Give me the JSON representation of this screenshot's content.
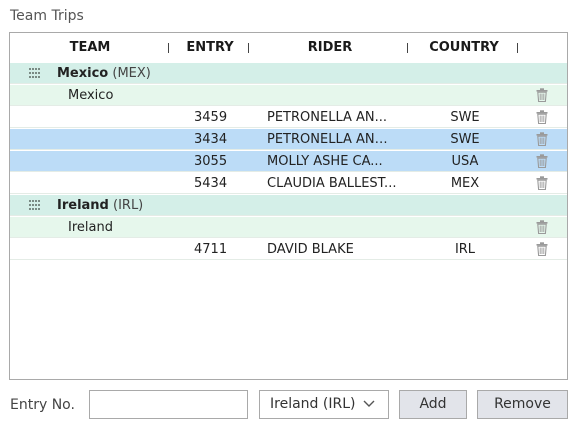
{
  "title": "Team Trips",
  "columns": {
    "team": "TEAM",
    "entry": "ENTRY",
    "rider": "RIDER",
    "country": "COUNTRY"
  },
  "groups": [
    {
      "name": "Mexico",
      "code": "(MEX)",
      "subgroup": "Mexico",
      "rows": [
        {
          "entry": "3459",
          "rider": "PETRONELLA AN...",
          "country": "SWE",
          "selected": false
        },
        {
          "entry": "3434",
          "rider": "PETRONELLA AND...",
          "country": "SWE",
          "selected": true
        },
        {
          "entry": "3055",
          "rider": "MOLLY ASHE CA...",
          "country": "USA",
          "selected": true
        },
        {
          "entry": "5434",
          "rider": "CLAUDIA BALLEST...",
          "country": "MEX",
          "selected": false
        }
      ]
    },
    {
      "name": "Ireland",
      "code": "(IRL)",
      "subgroup": "Ireland",
      "rows": [
        {
          "entry": "4711",
          "rider": "DAVID BLAKE",
          "country": "IRL",
          "selected": false
        }
      ]
    }
  ],
  "footer": {
    "entry_label": "Entry No.",
    "entry_value": "",
    "team_select": "Ireland (IRL)",
    "add_label": "Add",
    "remove_label": "Remove"
  },
  "icons": {
    "drag": "drag-handle-icon",
    "delete": "trash-icon",
    "dropdown": "chevron-down-icon"
  },
  "colors": {
    "group_bg": "#d4efe8",
    "subgroup_bg": "#e6f7ec",
    "selected_bg": "#bcdcf7",
    "button_bg": "#e2e4ea"
  }
}
